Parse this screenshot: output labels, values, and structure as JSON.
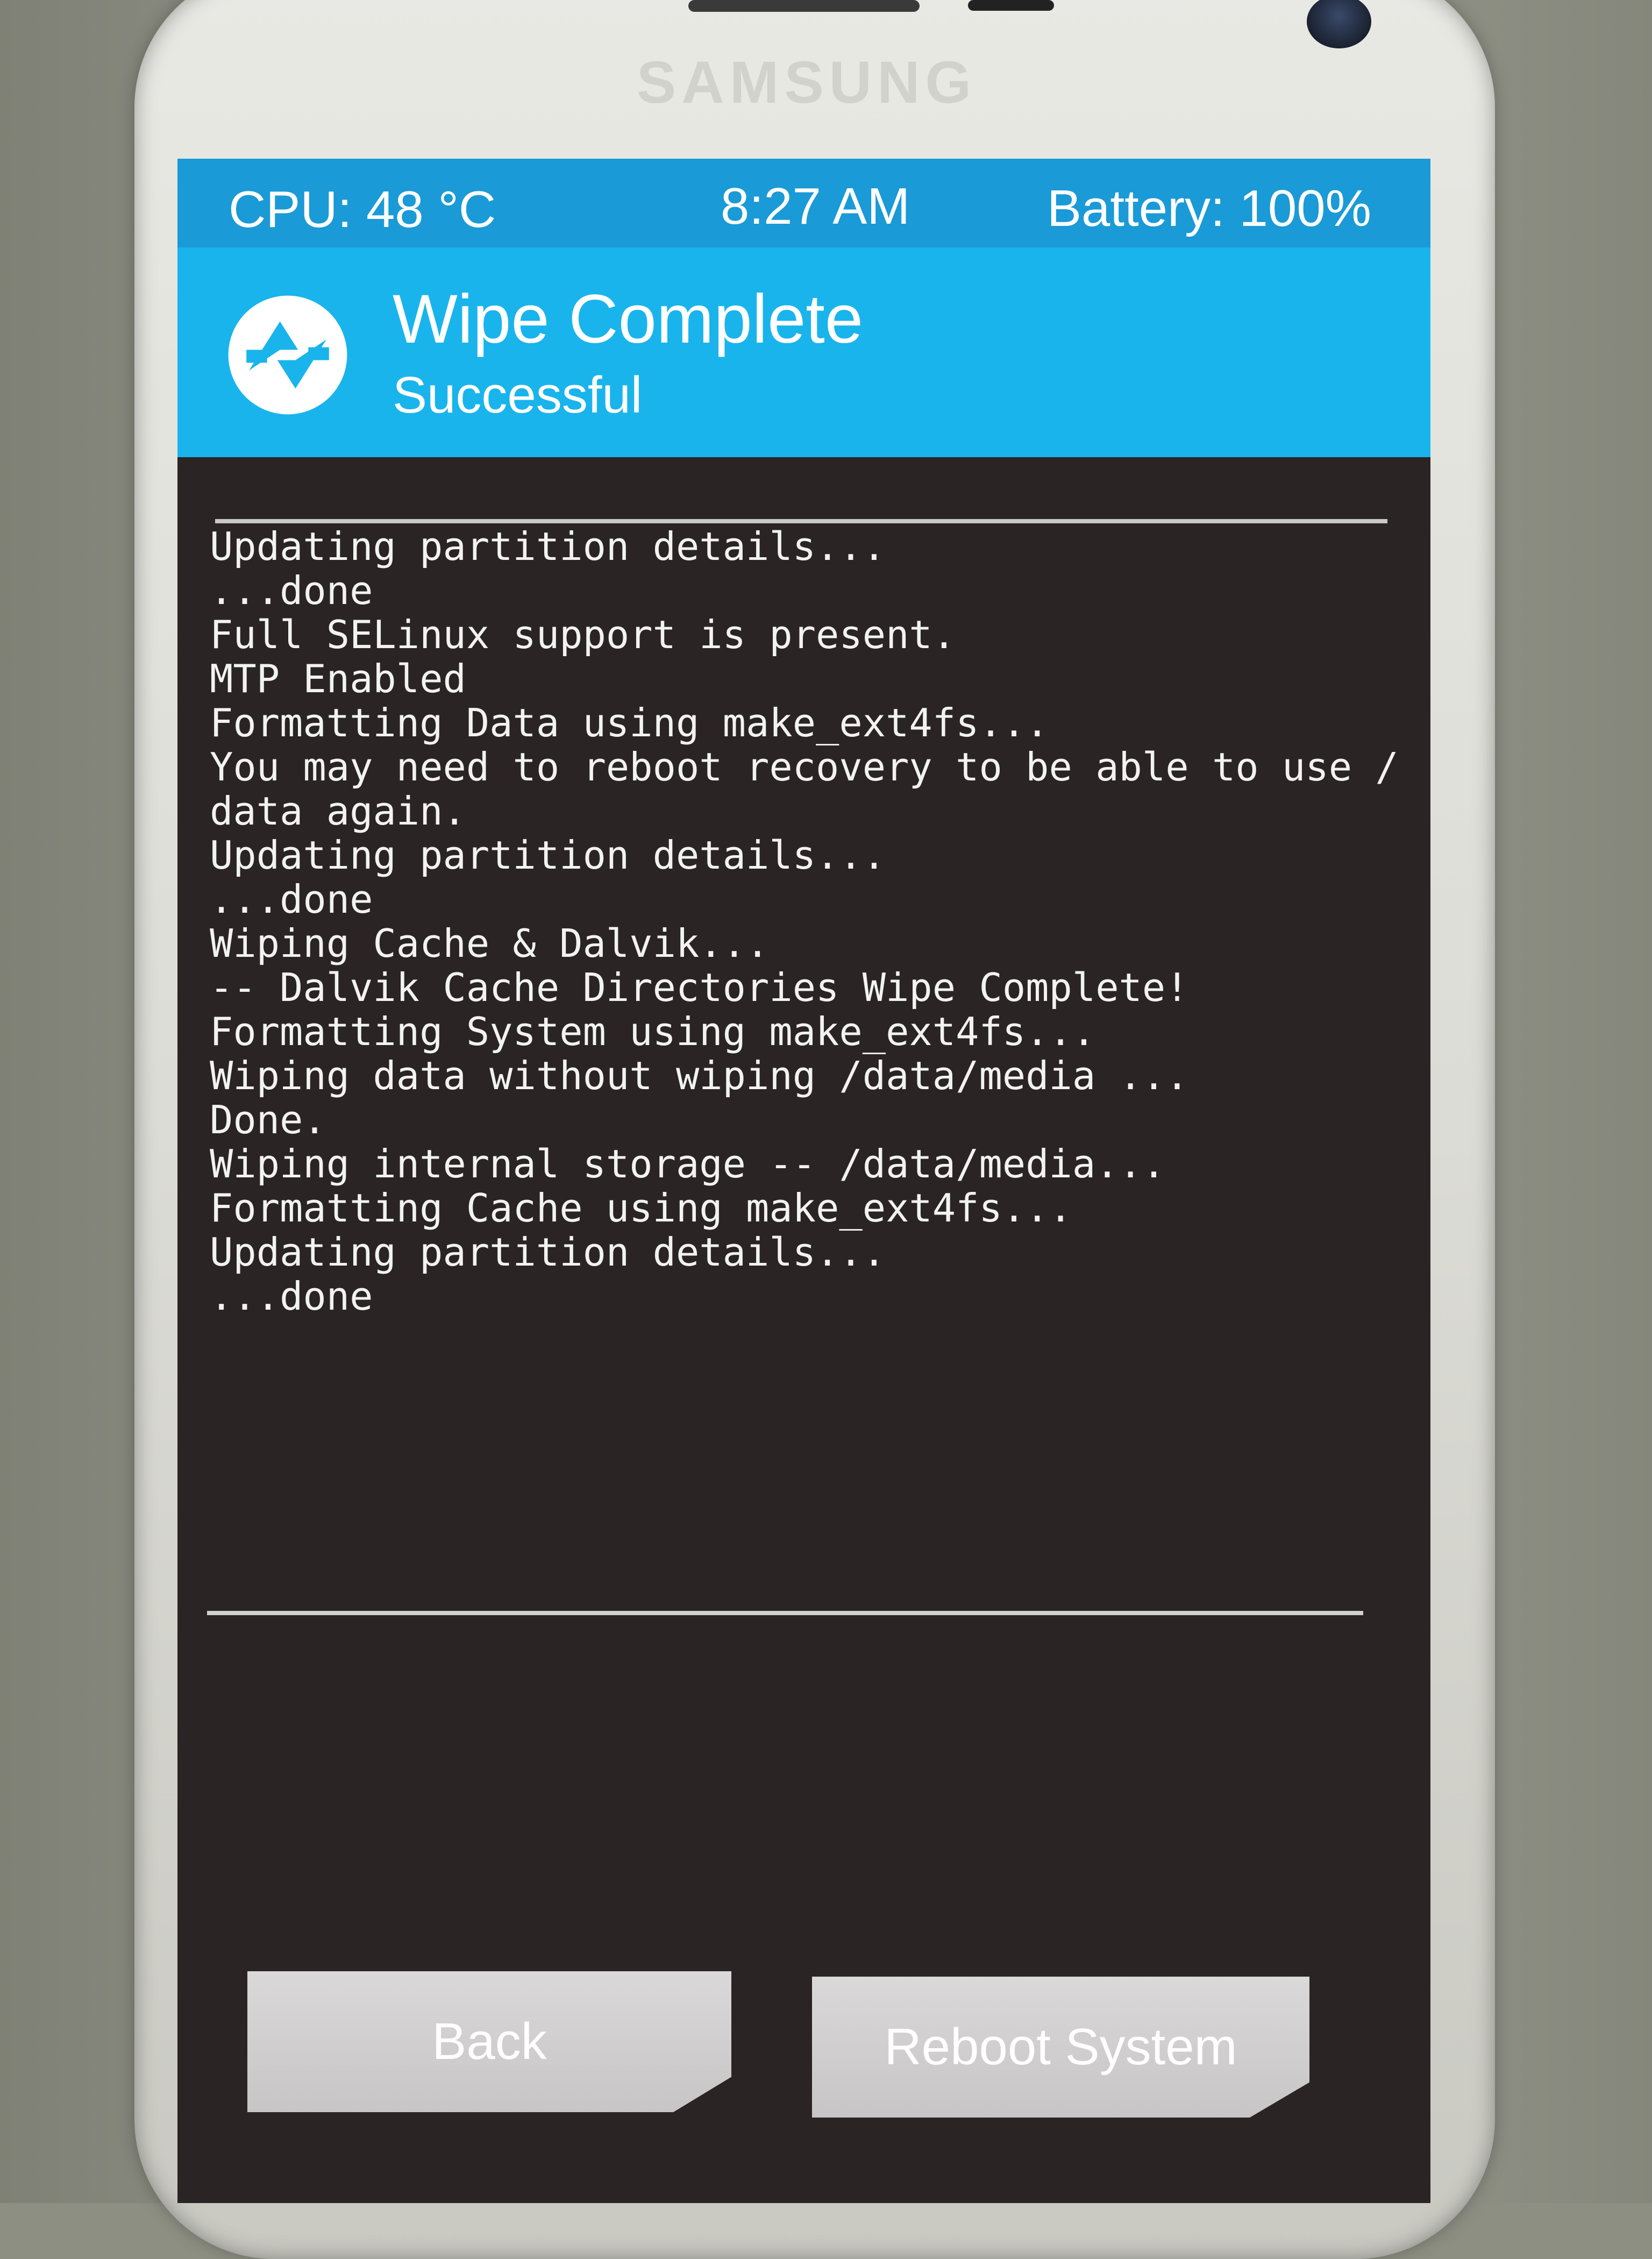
{
  "device": {
    "brand": "SAMSUNG"
  },
  "statusbar": {
    "cpu": "CPU: 48 °C",
    "time": "8:27 AM",
    "battery": "Battery: 100%"
  },
  "header": {
    "title": "Wipe Complete",
    "subtitle": "Successful"
  },
  "console": {
    "lines": [
      "Updating partition details...",
      "...done",
      "Full SELinux support is present.",
      "MTP Enabled",
      "Formatting Data using make_ext4fs...",
      "You may need to reboot recovery to be able to use /",
      "data again.",
      "Updating partition details...",
      "...done",
      "Wiping Cache & Dalvik...",
      "-- Dalvik Cache Directories Wipe Complete!",
      "Formatting System using make_ext4fs...",
      "Wiping data without wiping /data/media ...",
      "Done.",
      "Wiping internal storage -- /data/media...",
      "Formatting Cache using make_ext4fs...",
      "Updating partition details...",
      "...done"
    ]
  },
  "buttons": {
    "back": "Back",
    "reboot": "Reboot System"
  },
  "colors": {
    "statusbar": "#1a9ad6",
    "header": "#19b4ec",
    "console_bg": "#2a2424",
    "button": "#d0cece"
  }
}
